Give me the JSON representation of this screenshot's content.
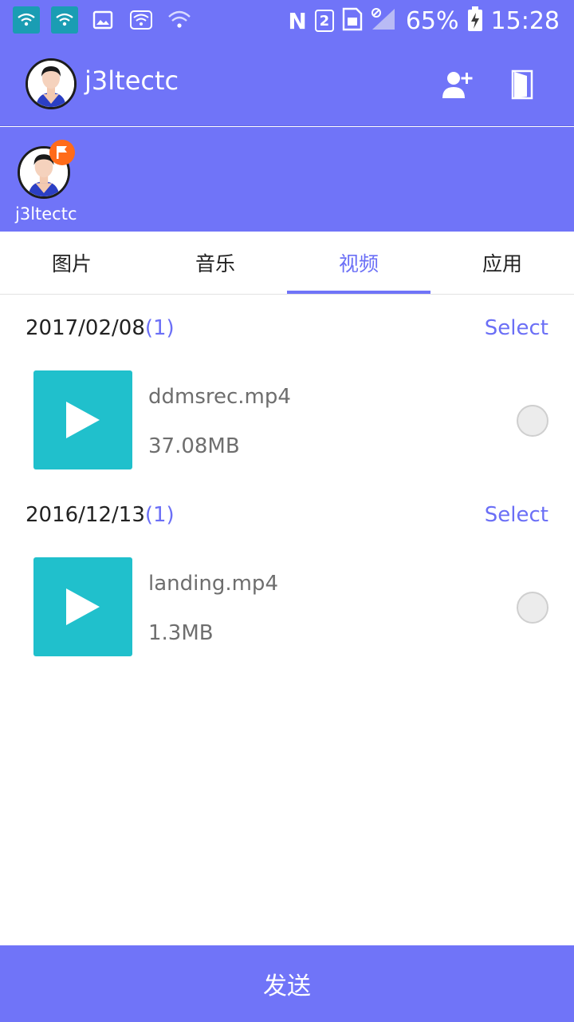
{
  "status_bar": {
    "battery_percent": "65%",
    "time": "15:28",
    "nfc_label": "N",
    "sim_slot": "2",
    "icons": [
      "wifi-hotspot-icon",
      "wifi-hotspot-icon",
      "image-icon",
      "wifi-icon",
      "wifi-weak-icon",
      "nfc-icon",
      "sim-2-icon",
      "sim-card-icon",
      "no-signal-icon",
      "battery-charging-icon"
    ]
  },
  "header": {
    "username": "j3ltectc",
    "actions": [
      "add-user-icon",
      "exit-door-icon"
    ]
  },
  "device": {
    "name": "j3ltectc",
    "badge_color": "#ff6b1a"
  },
  "tabs": [
    {
      "label": "图片",
      "active": false
    },
    {
      "label": "音乐",
      "active": false
    },
    {
      "label": "视频",
      "active": true
    },
    {
      "label": "应用",
      "active": false
    }
  ],
  "groups": [
    {
      "date": "2017/02/08",
      "count": "(1)",
      "select_label": "Select",
      "files": [
        {
          "name": "ddmsrec.mp4",
          "size": "37.08MB",
          "selected": false
        }
      ]
    },
    {
      "date": "2016/12/13",
      "count": "(1)",
      "select_label": "Select",
      "files": [
        {
          "name": "landing.mp4",
          "size": "1.3MB",
          "selected": false
        }
      ]
    }
  ],
  "send_button": {
    "label": "发送"
  },
  "colors": {
    "accent": "#7074f8",
    "thumbnail": "#20c0cc",
    "badge": "#ff6b1a"
  }
}
